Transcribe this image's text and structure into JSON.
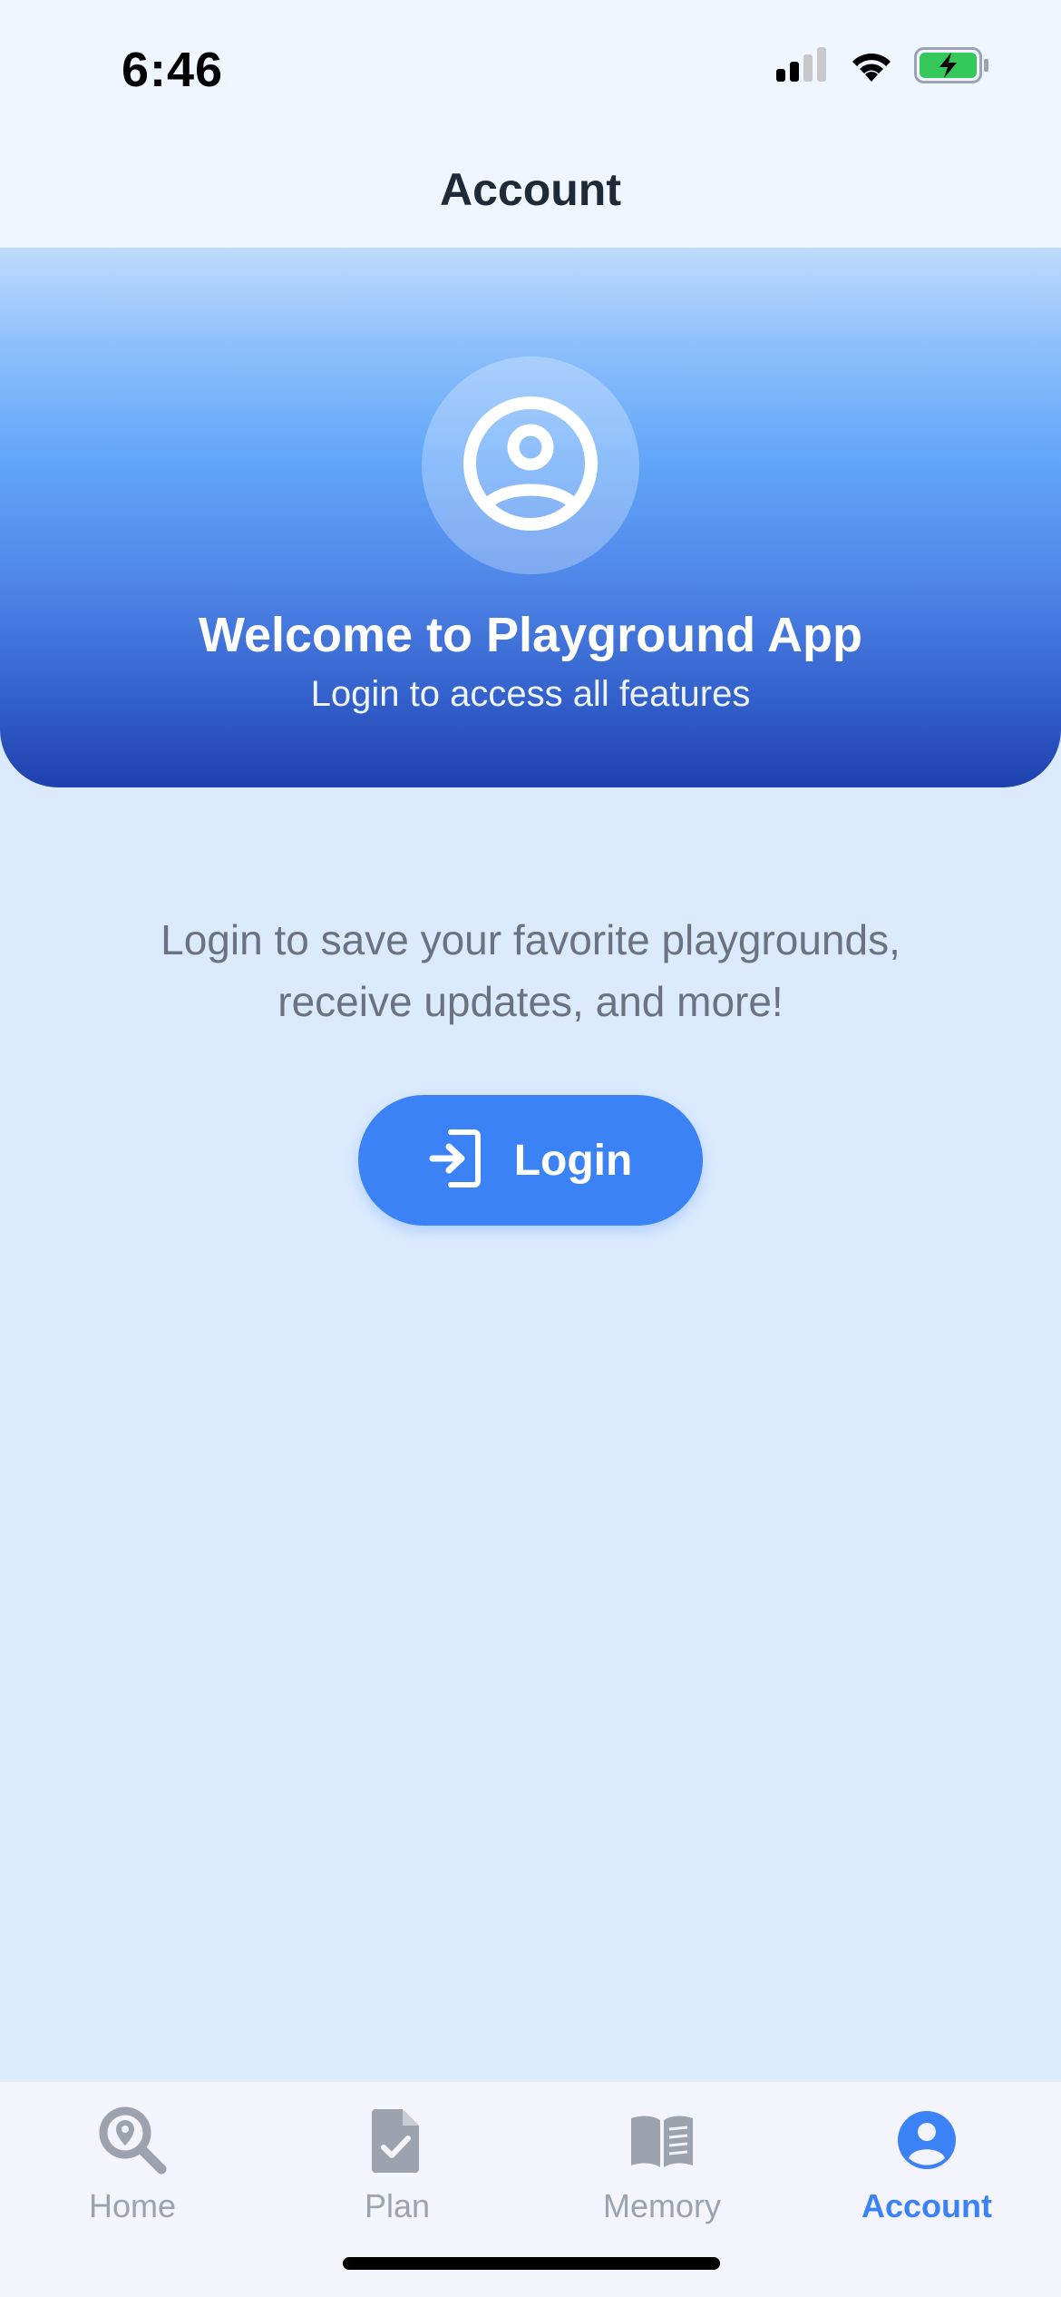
{
  "status_bar": {
    "time": "6:46"
  },
  "header": {
    "title": "Account"
  },
  "hero": {
    "title": "Welcome to Playground App",
    "subtitle": "Login to access all features",
    "avatar_icon": "user-circle-icon"
  },
  "main": {
    "description": "Login to save your favorite playgrounds, receive updates, and more!",
    "login_button": {
      "label": "Login",
      "icon": "login-icon"
    }
  },
  "tab_bar": {
    "tabs": [
      {
        "label": "Home",
        "icon": "map-search-icon",
        "active": false
      },
      {
        "label": "Plan",
        "icon": "document-check-icon",
        "active": false
      },
      {
        "label": "Memory",
        "icon": "book-icon",
        "active": false
      },
      {
        "label": "Account",
        "icon": "user-circle-icon",
        "active": true
      }
    ]
  },
  "colors": {
    "accent": "#3b82f6",
    "background": "#dbeafe",
    "header_bg": "#eff6ff",
    "inactive_tab": "#9ca3af",
    "battery": "#34c759"
  }
}
